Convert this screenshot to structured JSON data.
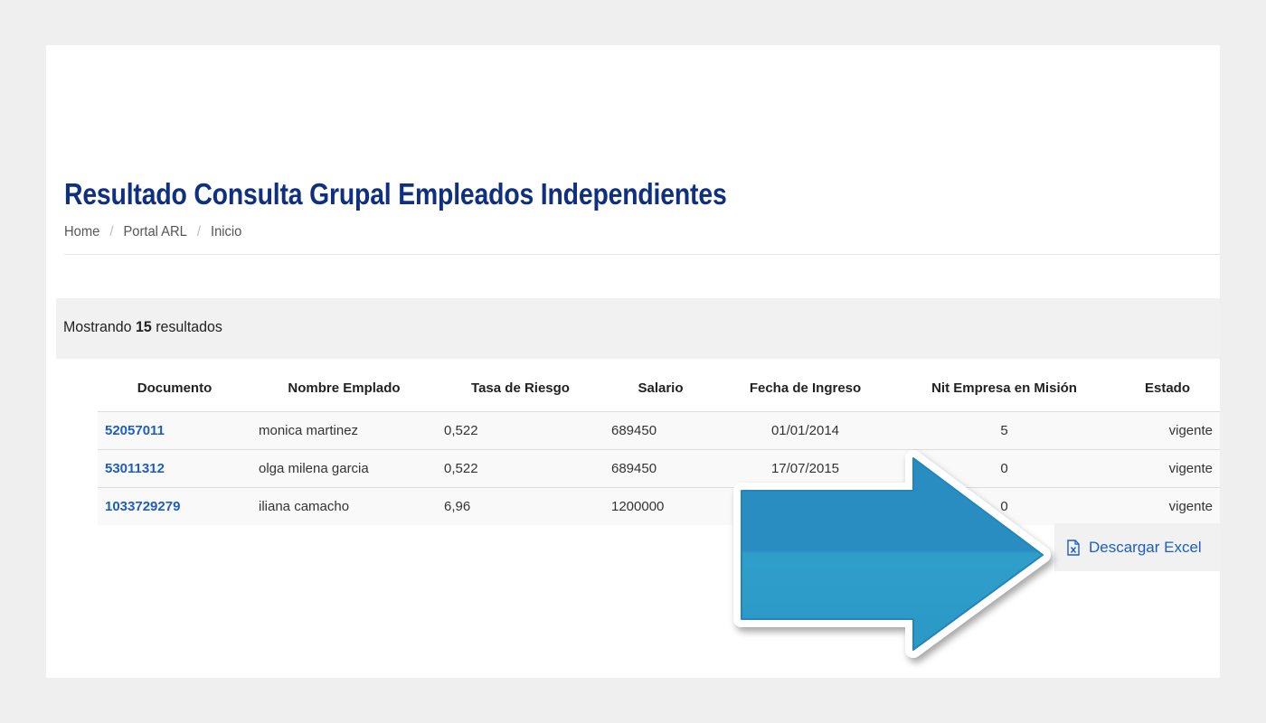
{
  "page": {
    "title": "Resultado Consulta Grupal Empleados Independientes",
    "breadcrumb": [
      "Home",
      "Portal ARL",
      "Inicio"
    ],
    "breadcrumb_separator": "/"
  },
  "results": {
    "prefix": "Mostrando",
    "count": "15",
    "suffix": "resultados"
  },
  "table": {
    "columns": [
      "Documento",
      "Nombre Emplado",
      "Tasa de Riesgo",
      "Salario",
      "Fecha de Ingreso",
      "Nit Empresa en Misión",
      "Estado"
    ],
    "rows": [
      {
        "documento": "52057011",
        "nombre": "monica martinez",
        "tasa": "0,522",
        "salario": "689450",
        "fecha": "01/01/2014",
        "nit": "5",
        "estado": "vigente"
      },
      {
        "documento": "53011312",
        "nombre": "olga milena garcia",
        "tasa": "0,522",
        "salario": "689450",
        "fecha": "17/07/2015",
        "nit": "0",
        "estado": "vigente"
      },
      {
        "documento": "1033729279",
        "nombre": "iliana camacho",
        "tasa": "6,96",
        "salario": "1200000",
        "fecha": "",
        "nit": "0",
        "estado": "vigente"
      }
    ]
  },
  "actions": {
    "download_excel": "Descargar Excel"
  },
  "colors": {
    "title": "#0f2f80",
    "link": "#1d5dc4",
    "arrow": "#2b93c5"
  }
}
